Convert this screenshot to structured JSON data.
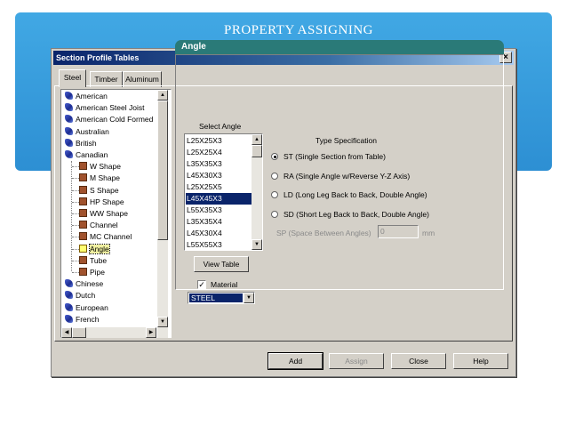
{
  "slide": {
    "title": "PROPERTY ASSIGNING"
  },
  "dialog": {
    "title": "Section Profile Tables",
    "close_glyph": "×",
    "tabs": [
      {
        "label": "Steel"
      },
      {
        "label": "Timber"
      },
      {
        "label": "Aluminum"
      }
    ],
    "tree": {
      "countries_top": [
        "American",
        "American Steel Joist",
        "American Cold Formed",
        "Australian",
        "British",
        "Canadian"
      ],
      "canadian_children": [
        "W Shape",
        "M Shape",
        "S Shape",
        "HP Shape",
        "WW Shape",
        "Channel",
        "MC Channel",
        "Angle",
        "Tube",
        "Pipe"
      ],
      "selected": "Angle",
      "countries_bottom": [
        "Chinese",
        "Dutch",
        "European",
        "French"
      ]
    },
    "panel": {
      "header": "Angle",
      "select_angle_label": "Select Angle",
      "angle_list": [
        "L25X25X3",
        "L25X25X4",
        "L35X35X3",
        "L45X30X3",
        "L25X25X5",
        "L45X45X3",
        "L55X35X3",
        "L35X35X4",
        "L45X30X4",
        "L55X55X3"
      ],
      "selected_angle": "L45X45X3",
      "view_table_label": "View Table",
      "material_label": "Material",
      "material_checked": "✓",
      "material_value": "STEEL",
      "type_spec_label": "Type Specification",
      "type_options": [
        {
          "label": "ST (Single Section from Table)",
          "checked": true
        },
        {
          "label": "RA (Single Angle w/Reverse Y-Z Axis)",
          "checked": false
        },
        {
          "label": "LD (Long Leg Back to Back, Double Angle)",
          "checked": false
        },
        {
          "label": "SD (Short Leg Back to Back, Double Angle)",
          "checked": false
        }
      ],
      "sp_label": "SP (Space Between Angles)",
      "sp_value": "0",
      "sp_unit": "mm"
    },
    "buttons": {
      "add": "Add",
      "assign": "Assign",
      "close": "Close",
      "help": "Help"
    }
  }
}
